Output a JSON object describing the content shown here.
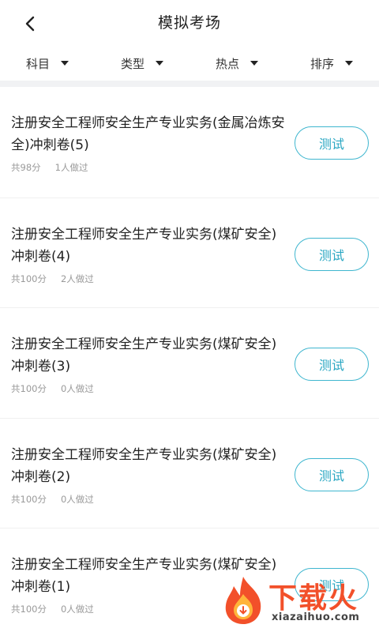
{
  "header": {
    "title": "模拟考场",
    "back_icon": "chevron-left-icon"
  },
  "filters": [
    {
      "label": "科目"
    },
    {
      "label": "类型"
    },
    {
      "label": "热点"
    },
    {
      "label": "排序"
    }
  ],
  "items": [
    {
      "title": "注册安全工程师安全生产专业实务(金属冶炼安全)冲刺卷(5)",
      "score": "共98分",
      "people": "1人做过",
      "button": "测试"
    },
    {
      "title": "注册安全工程师安全生产专业实务(煤矿安全)冲刺卷(4)",
      "score": "共100分",
      "people": "2人做过",
      "button": "测试"
    },
    {
      "title": "注册安全工程师安全生产专业实务(煤矿安全)冲刺卷(3)",
      "score": "共100分",
      "people": "0人做过",
      "button": "测试"
    },
    {
      "title": "注册安全工程师安全生产专业实务(煤矿安全)冲刺卷(2)",
      "score": "共100分",
      "people": "0人做过",
      "button": "测试"
    },
    {
      "title": "注册安全工程师安全生产专业实务(煤矿安全)冲刺卷(1)",
      "score": "共100分",
      "people": "0人做过",
      "button": "测试"
    }
  ],
  "watermark": {
    "text": "下载火",
    "sub": "xiazaihuo.com",
    "color": "#f2502a"
  },
  "colors": {
    "accent": "#2aa7c3",
    "separator": "#f1f2f4",
    "meta": "#9a9a9a"
  }
}
